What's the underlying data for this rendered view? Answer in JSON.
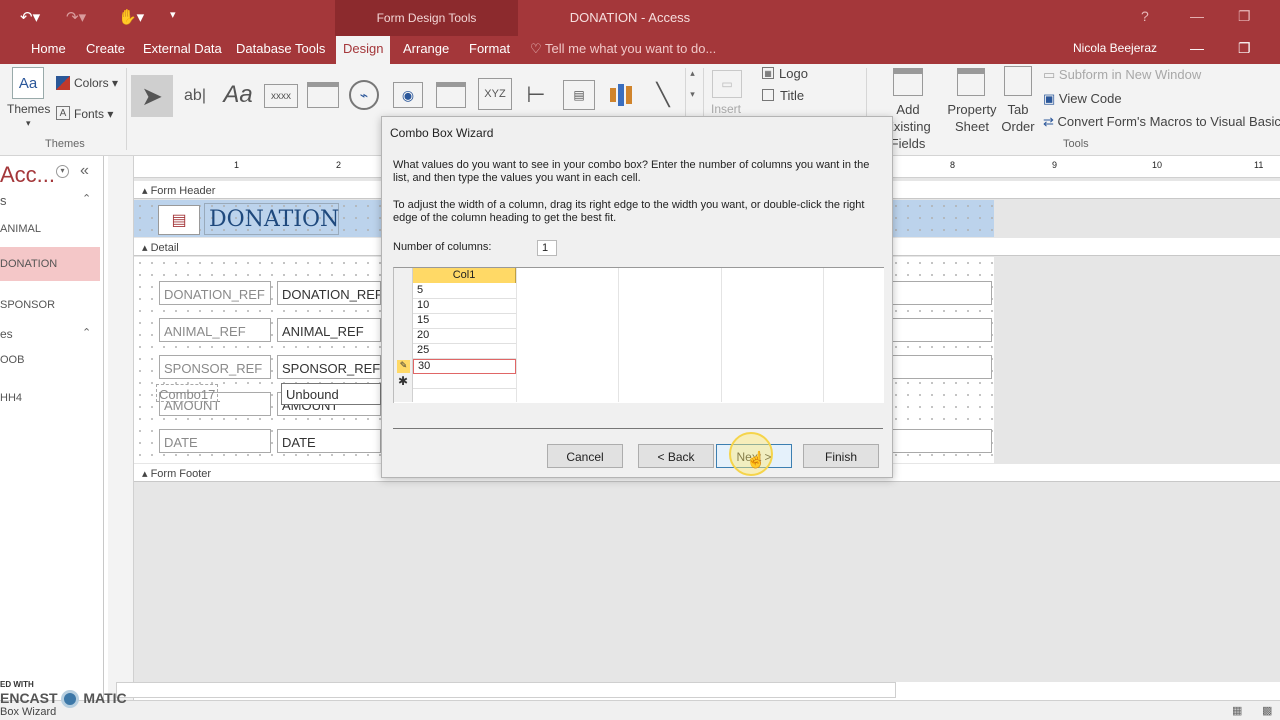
{
  "window": {
    "title": "DONATION - Access",
    "contextual_tab_group": "Form Design Tools",
    "user": "Nicola Beejeraz",
    "tell_me": "Tell me what you want to do..."
  },
  "tabs": [
    "Home",
    "Create",
    "External Data",
    "Database Tools",
    "Design",
    "Arrange",
    "Format"
  ],
  "ribbon": {
    "themes": {
      "themes_label": "Themes",
      "colors_label": "Colors",
      "fonts_label": "Fonts",
      "group": "Themes"
    },
    "header_footer": {
      "logo": "Logo",
      "title": "Title",
      "insert": "Insert"
    },
    "tools": {
      "add_existing_fields": "Add Existing Fields",
      "property_sheet": "Property Sheet",
      "tab_order": "Tab Order",
      "subform_new_window": "Subform in New Window",
      "view_code": "View Code",
      "convert_macros": "Convert Form's Macros to Visual Basic",
      "group": "Tools"
    }
  },
  "nav": {
    "title": "Acc...",
    "items": [
      "ANIMAL",
      "DONATION",
      "SPONSOR"
    ],
    "section2": "es",
    "items2": [
      "OOB",
      "HH4"
    ],
    "top_partial": "s"
  },
  "form": {
    "header_section": "Form Header",
    "header_title": "DONATION",
    "detail_section": "Detail",
    "footer_section": "Form Footer",
    "fields": [
      {
        "label": "DONATION_REF",
        "value": "DONATION_REF"
      },
      {
        "label": "ANIMAL_REF",
        "value": "ANIMAL_REF"
      },
      {
        "label": "SPONSOR_REF",
        "value": "SPONSOR_REF"
      },
      {
        "label": "AMOUNT",
        "value": "AMOUNT"
      },
      {
        "label": "DATE",
        "value": "DATE"
      }
    ],
    "combo_label": "Combo17",
    "combo_value": "Unbound"
  },
  "dialog": {
    "title": "Combo Box Wizard",
    "instruction1": "What values do you want to see in your combo box? Enter the number of columns you want in the list, and then type the values you want in each cell.",
    "instruction2": "To adjust the width of a column, drag its right edge to the width you want, or double-click the right edge of the column heading to get the best fit.",
    "columns_label": "Number of columns:",
    "columns_value": "1",
    "column_header": "Col1",
    "rows": [
      "5",
      "10",
      "15",
      "20",
      "25",
      "30"
    ],
    "buttons": {
      "cancel": "Cancel",
      "back": "< Back",
      "next": "Next >",
      "finish": "Finish"
    }
  },
  "ruler_numbers": [
    "1",
    "2",
    "8",
    "9",
    "10",
    "11"
  ],
  "statusbar": {
    "text": "Box Wizard",
    "watermark_top": "ED WITH",
    "watermark": "ENCAST",
    "watermark2": "MATIC"
  },
  "colors": {
    "accent": "#a4373a",
    "contextual": "#8c2a2d",
    "nav_selected": "#f4c7c8"
  }
}
